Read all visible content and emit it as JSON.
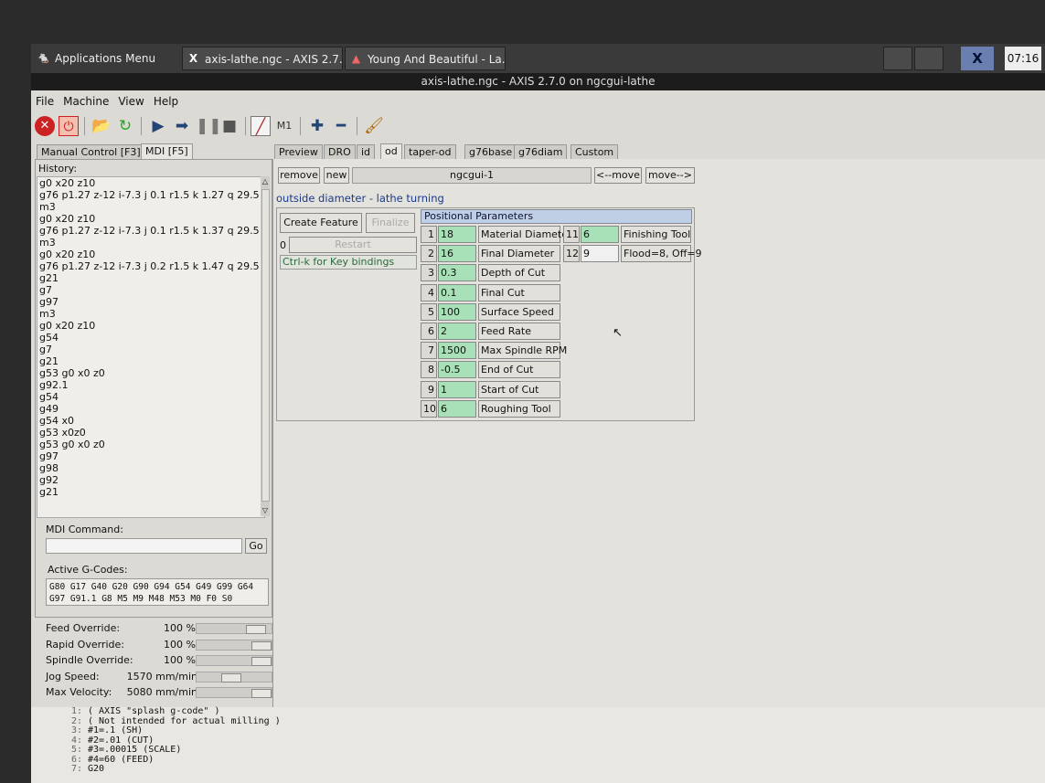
{
  "taskbar": {
    "apps_menu": "Applications Menu",
    "task1": "axis-lathe.ngc - AXIS 2.7...",
    "task2": "Young And Beautiful - La...",
    "x_label": "X",
    "clock": "07:16"
  },
  "window": {
    "title": "axis-lathe.ngc - AXIS 2.7.0 on ngcgui-lathe"
  },
  "menu": [
    "File",
    "Machine",
    "View",
    "Help"
  ],
  "left_tabs": {
    "manual": "Manual Control [F3]",
    "mdi": "MDI [F5]"
  },
  "history": {
    "label": "History:",
    "lines": [
      "g0 x20 z10",
      "g76 p1.27 z-12 i-7.3 j 0.1 r1.5 k 1.27 q 29.5",
      "m3",
      "g0 x20 z10",
      "g76 p1.27 z-12 i-7.3 j 0.1 r1.5 k 1.37 q 29.5",
      "m3",
      "g0 x20 z10",
      "g76 p1.27 z-12 i-7.3 j 0.2 r1.5 k 1.47 q 29.5",
      "g21",
      "g7",
      "g97",
      "m3",
      "g0 x20 z10",
      "g54",
      "g7",
      "g21",
      "g53 g0 x0 z0",
      "g92.1",
      "g54",
      "g49",
      "g54 x0",
      "g53 x0z0",
      "g53 g0 x0 z0",
      "g97",
      "g98",
      "g92",
      "g21"
    ]
  },
  "mdi": {
    "label": "MDI Command:",
    "value": "",
    "go": "Go"
  },
  "active_gcodes": {
    "label": "Active G-Codes:",
    "line1": "G80 G17 G40 G20 G90 G94 G54 G49 G99 G64",
    "line2": "G97 G91.1 G8 M5 M9 M48 M53 M0 F0 S0"
  },
  "overrides": [
    {
      "label": "Feed Override:",
      "value": "100 %",
      "level": 0.9
    },
    {
      "label": "Rapid Override:",
      "value": "100 %",
      "level": 1.0
    },
    {
      "label": "Spindle Override:",
      "value": "100 %",
      "level": 1.0
    },
    {
      "label": "Jog Speed:",
      "value": "1570 mm/min",
      "level": 0.45
    },
    {
      "label": "Max Velocity:",
      "value": "5080 mm/min",
      "level": 1.0
    }
  ],
  "right_tabs": [
    "Preview",
    "DRO",
    "id",
    "od",
    "taper-od",
    "g76base",
    "g76diam",
    "Custom"
  ],
  "ngcgui": {
    "remove": "remove",
    "new": "new",
    "name": "ngcgui-1",
    "move_left": "<--move",
    "move_right": "move-->",
    "description": "outside diameter - lathe turning",
    "create_feature": "Create Feature",
    "finalize": "Finalize",
    "restart_num": "0",
    "restart": "Restart",
    "keybind": "Ctrl-k for Key bindings",
    "params_title": "Positional Parameters",
    "params_left": [
      {
        "n": "1",
        "v": "18",
        "name": "Material Diameter"
      },
      {
        "n": "2",
        "v": "16",
        "name": "Final Diameter"
      },
      {
        "n": "3",
        "v": "0.3",
        "name": "Depth of Cut"
      },
      {
        "n": "4",
        "v": "0.1",
        "name": "Final Cut"
      },
      {
        "n": "5",
        "v": "100",
        "name": "Surface Speed"
      },
      {
        "n": "6",
        "v": "2",
        "name": "Feed Rate"
      },
      {
        "n": "7",
        "v": "1500",
        "name": "Max Spindle RPM"
      },
      {
        "n": "8",
        "v": "-0.5",
        "name": "End of Cut"
      },
      {
        "n": "9",
        "v": "1",
        "name": "Start of Cut"
      },
      {
        "n": "10",
        "v": "6",
        "name": "Roughing Tool"
      }
    ],
    "params_right": [
      {
        "n": "11",
        "v": "6",
        "name": "Finishing Tool"
      },
      {
        "n": "12",
        "v": "9",
        "name": "Flood=8, Off=9"
      }
    ]
  },
  "code": [
    {
      "n": "1:",
      "t": "( AXIS \"splash g-code\" )"
    },
    {
      "n": "2:",
      "t": "( Not intended for actual milling )"
    },
    {
      "n": "3:",
      "t": "#1=.1 (SH)"
    },
    {
      "n": "4:",
      "t": "#2=.01 (CUT)"
    },
    {
      "n": "5:",
      "t": "#3=.00015 (SCALE)"
    },
    {
      "n": "6:",
      "t": "#4=60 (FEED)"
    },
    {
      "n": "7:",
      "t": "G20"
    }
  ]
}
